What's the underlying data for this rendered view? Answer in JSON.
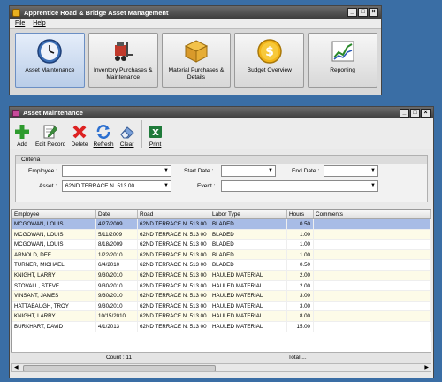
{
  "main": {
    "title": "Apprentice Road & Bridge Asset Management",
    "menu": [
      "File",
      "Help"
    ],
    "buttons": [
      {
        "label": "Asset Maintenance",
        "icon": "clock-icon"
      },
      {
        "label": "Inventory Purchases & Maintenance",
        "icon": "forklift-icon"
      },
      {
        "label": "Material Purchases & Details",
        "icon": "boxes-icon"
      },
      {
        "label": "Budget Overview",
        "icon": "dollar-coin-icon"
      },
      {
        "label": "Reporting",
        "icon": "line-chart-icon"
      }
    ]
  },
  "child": {
    "title": "Asset Maintenance",
    "toolbar": {
      "add": "Add",
      "edit": "Edit Record",
      "delete": "Delete",
      "refresh": "Refresh",
      "clear": "Clear",
      "print": "Print"
    },
    "criteria": {
      "header": "Criteria",
      "employee_label": "Employee :",
      "employee_value": "",
      "start_label": "Start Date :",
      "start_value": "",
      "end_label": "End Date :",
      "end_value": "",
      "asset_label": "Asset :",
      "asset_value": "62ND TERRACE N. 513 00",
      "event_label": "Event :",
      "event_value": ""
    },
    "grid": {
      "columns": [
        "Employee",
        "Date",
        "Road",
        "Labor Type",
        "Hours",
        "Comments"
      ],
      "rows": [
        [
          "MCGOWAN, LOUIS",
          "4/27/2009",
          "62ND TERRACE N. 513 00",
          "BLADED",
          "0.50",
          ""
        ],
        [
          "MCGOWAN, LOUIS",
          "5/11/2009",
          "62ND TERRACE N. 513 00",
          "BLADED",
          "1.00",
          ""
        ],
        [
          "MCGOWAN, LOUIS",
          "8/18/2009",
          "62ND TERRACE N. 513 00",
          "BLADED",
          "1.00",
          ""
        ],
        [
          "ARNOLD, DEE",
          "1/22/2010",
          "62ND TERRACE N. 513 00",
          "BLADED",
          "1.00",
          ""
        ],
        [
          "TURNER, MICHAEL",
          "6/4/2010",
          "62ND TERRACE N. 513 00",
          "BLADED",
          "0.50",
          ""
        ],
        [
          "KNIGHT, LARRY",
          "9/30/2010",
          "62ND TERRACE N. 513 00",
          "HAULED MATERIAL",
          "2.00",
          ""
        ],
        [
          "STOVALL, STEVE",
          "9/30/2010",
          "62ND TERRACE N. 513 00",
          "HAULED MATERIAL",
          "2.00",
          ""
        ],
        [
          "VINSANT, JAMES",
          "9/30/2010",
          "62ND TERRACE N. 513 00",
          "HAULED MATERIAL",
          "3.00",
          ""
        ],
        [
          "HATTABAUGH, TROY",
          "9/30/2010",
          "62ND TERRACE N. 513 00",
          "HAULED MATERIAL",
          "3.00",
          ""
        ],
        [
          "KNIGHT, LARRY",
          "10/15/2010",
          "62ND TERRACE N. 513 00",
          "HAULED MATERIAL",
          "8.00",
          ""
        ],
        [
          "BURKHART, DAVID",
          "4/1/2013",
          "62ND TERRACE N. 513 00",
          "HAULED MATERIAL",
          "15.00",
          ""
        ]
      ],
      "selected_row": 0,
      "count_text": "Count : 11",
      "total_text": "Total ..."
    }
  }
}
